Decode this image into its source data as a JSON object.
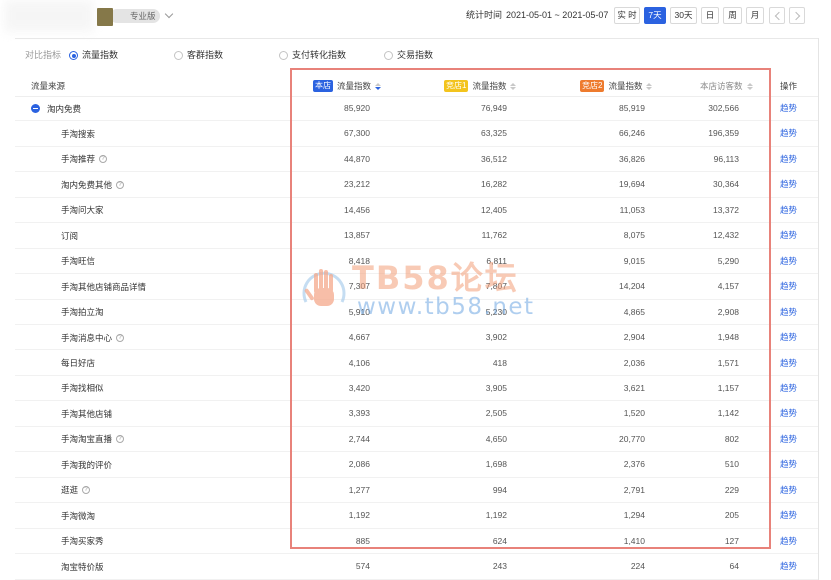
{
  "header": {
    "avatar_icon": "store-avatar-icon",
    "edition_badge": "专业版",
    "edition_dropdown_icon": "chevron-down-icon",
    "stat_time_label": "统计时间",
    "stat_time_range": "2021-05-01 ~ 2021-05-07",
    "period_buttons": [
      {
        "label": "实 时",
        "active": false
      },
      {
        "label": "7天",
        "active": true
      },
      {
        "label": "30天",
        "active": false
      },
      {
        "label": "日",
        "active": false
      },
      {
        "label": "周",
        "active": false
      },
      {
        "label": "月",
        "active": false
      }
    ],
    "prev_icon": "chevron-left-icon",
    "next_icon": "chevron-right-icon"
  },
  "compare": {
    "label": "对比指标",
    "options": [
      {
        "label": "流量指数",
        "selected": true
      },
      {
        "label": "客群指数",
        "selected": false
      },
      {
        "label": "支付转化指数",
        "selected": false
      },
      {
        "label": "交易指数",
        "selected": false
      }
    ]
  },
  "table": {
    "columns": {
      "source": "流量来源",
      "own": {
        "badge": "本店",
        "label": "流量指数",
        "sort_icon": "sort-desc-icon"
      },
      "rival1": {
        "badge": "竞店1",
        "label": "流量指数",
        "sort_icon": "sort-icon"
      },
      "rival2": {
        "badge": "竞店2",
        "label": "流量指数",
        "sort_icon": "sort-icon"
      },
      "visitors": {
        "label": "本店访客数",
        "sort_icon": "sort-icon"
      },
      "action": "操作"
    },
    "rows": [
      {
        "name": "淘内免费",
        "level": 0,
        "expanded": true,
        "has_info": false,
        "own": "85,920",
        "rival1": "76,949",
        "rival2": "85,919",
        "visitors": "302,566",
        "action": "趋势"
      },
      {
        "name": "手淘搜索",
        "level": 1,
        "has_info": false,
        "own": "67,300",
        "rival1": "63,325",
        "rival2": "66,246",
        "visitors": "196,359",
        "action": "趋势"
      },
      {
        "name": "手淘推荐",
        "level": 1,
        "has_info": true,
        "own": "44,870",
        "rival1": "36,512",
        "rival2": "36,826",
        "visitors": "96,113",
        "action": "趋势"
      },
      {
        "name": "淘内免费其他",
        "level": 1,
        "has_info": true,
        "own": "23,212",
        "rival1": "16,282",
        "rival2": "19,694",
        "visitors": "30,364",
        "action": "趋势"
      },
      {
        "name": "手淘问大家",
        "level": 1,
        "has_info": false,
        "own": "14,456",
        "rival1": "12,405",
        "rival2": "11,053",
        "visitors": "13,372",
        "action": "趋势"
      },
      {
        "name": "订阅",
        "level": 1,
        "has_info": false,
        "own": "13,857",
        "rival1": "11,762",
        "rival2": "8,075",
        "visitors": "12,432",
        "action": "趋势"
      },
      {
        "name": "手淘旺信",
        "level": 1,
        "has_info": false,
        "own": "8,418",
        "rival1": "6,811",
        "rival2": "9,015",
        "visitors": "5,290",
        "action": "趋势"
      },
      {
        "name": "手淘其他店铺商品详情",
        "level": 1,
        "has_info": false,
        "own": "7,307",
        "rival1": "7,807",
        "rival2": "14,204",
        "visitors": "4,157",
        "action": "趋势"
      },
      {
        "name": "手淘拍立淘",
        "level": 1,
        "has_info": false,
        "own": "5,910",
        "rival1": "5,230",
        "rival2": "4,865",
        "visitors": "2,908",
        "action": "趋势"
      },
      {
        "name": "手淘消息中心",
        "level": 1,
        "has_info": true,
        "own": "4,667",
        "rival1": "3,902",
        "rival2": "2,904",
        "visitors": "1,948",
        "action": "趋势"
      },
      {
        "name": "每日好店",
        "level": 1,
        "has_info": false,
        "own": "4,106",
        "rival1": "418",
        "rival2": "2,036",
        "visitors": "1,571",
        "action": "趋势"
      },
      {
        "name": "手淘找相似",
        "level": 1,
        "has_info": false,
        "own": "3,420",
        "rival1": "3,905",
        "rival2": "3,621",
        "visitors": "1,157",
        "action": "趋势"
      },
      {
        "name": "手淘其他店铺",
        "level": 1,
        "has_info": false,
        "own": "3,393",
        "rival1": "2,505",
        "rival2": "1,520",
        "visitors": "1,142",
        "action": "趋势"
      },
      {
        "name": "手淘淘宝直播",
        "level": 1,
        "has_info": true,
        "own": "2,744",
        "rival1": "4,650",
        "rival2": "20,770",
        "visitors": "802",
        "action": "趋势"
      },
      {
        "name": "手淘我的评价",
        "level": 1,
        "has_info": false,
        "own": "2,086",
        "rival1": "1,698",
        "rival2": "2,376",
        "visitors": "510",
        "action": "趋势"
      },
      {
        "name": "逛逛",
        "level": 1,
        "has_info": true,
        "own": "1,277",
        "rival1": "994",
        "rival2": "2,791",
        "visitors": "229",
        "action": "趋势"
      },
      {
        "name": "手淘微淘",
        "level": 1,
        "has_info": false,
        "own": "1,192",
        "rival1": "1,192",
        "rival2": "1,294",
        "visitors": "205",
        "action": "趋势"
      },
      {
        "name": "手淘买家秀",
        "level": 1,
        "has_info": false,
        "own": "885",
        "rival1": "624",
        "rival2": "1,410",
        "visitors": "127",
        "action": "趋势"
      },
      {
        "name": "淘宝特价版",
        "level": 1,
        "has_info": false,
        "own": "574",
        "rival1": "243",
        "rival2": "224",
        "visitors": "64",
        "action": "趋势"
      }
    ]
  },
  "watermark": {
    "logo_icon": "hand-logo-icon",
    "title": "TB58论坛",
    "url": "www.tb58.net"
  },
  "colors": {
    "accent": "#2b62e0",
    "rival1_badge": "#f3c41d",
    "rival2_badge": "#ee7b2e",
    "highlight_box": "#e8827a",
    "link": "#2f66e0"
  }
}
